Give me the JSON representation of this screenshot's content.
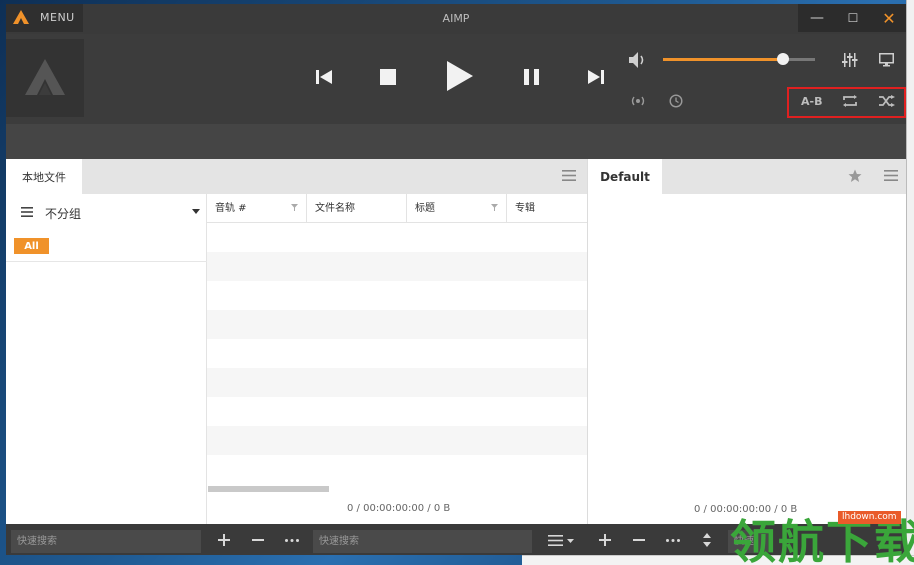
{
  "titlebar": {
    "menu_label": "MENU",
    "app_title": "AIMP",
    "minimize_glyph": "—",
    "maximize_glyph": "☐",
    "close_glyph": "✕"
  },
  "player": {
    "volume_level": 0.79,
    "ab_label": "A-B",
    "icons": [
      "speaker-icon",
      "equalizer-icon",
      "monitor-icon",
      "radio-icon",
      "clock-icon",
      "repeat-icon",
      "shuffle-icon",
      "previous-icon",
      "stop-icon",
      "play-icon",
      "pause-icon",
      "next-icon"
    ]
  },
  "library": {
    "tab_label": "本地文件",
    "group_label": "不分组",
    "all_badge": "All",
    "columns": [
      {
        "label": "音轨 #"
      },
      {
        "label": "文件名称"
      },
      {
        "label": "标题"
      },
      {
        "label": "专辑"
      }
    ],
    "status": "0 / 00:00:00:00 / 0 B"
  },
  "playlist": {
    "tab_label": "Default",
    "status": "0 / 00:00:00:00 / 0 B"
  },
  "bottombar": {
    "search_placeholder_left": "快速搜索",
    "search_placeholder_mid": "快速搜索",
    "search_placeholder_right": "快速"
  },
  "watermark": {
    "text": "领航下载",
    "url": "lhdown.com"
  },
  "colors": {
    "accent": "#f0922a",
    "highlight": "#e02020",
    "watermark_green": "#3aa63a"
  }
}
